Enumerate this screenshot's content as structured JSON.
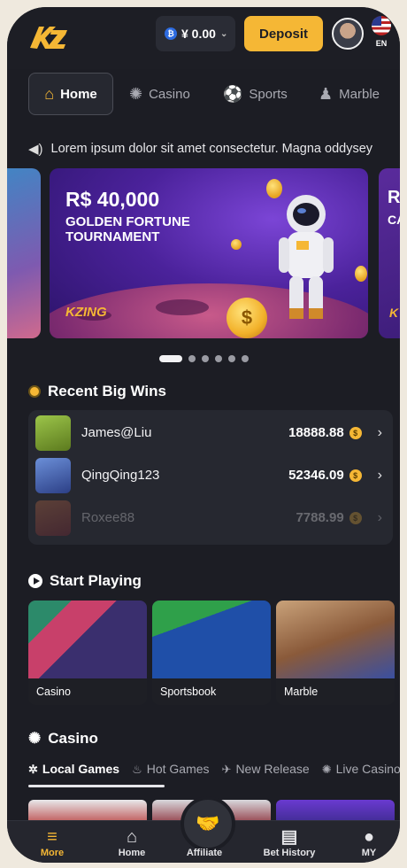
{
  "header": {
    "balance": "¥ 0.00",
    "balance_chevron": "⌄",
    "deposit_label": "Deposit",
    "language": "EN"
  },
  "nav": {
    "tabs": [
      {
        "label": "Home",
        "icon": "house-icon"
      },
      {
        "label": "Casino",
        "icon": "roulette-icon"
      },
      {
        "label": "Sports",
        "icon": "ball-icon"
      },
      {
        "label": "Marble",
        "icon": "chess-icon"
      }
    ]
  },
  "announcement": {
    "text": "Lorem ipsum dolor sit amet consectetur. Magna oddysey"
  },
  "banner": {
    "title": "R$ 40,000",
    "subtitle": "GOLDEN FORTUNE TOURNAMENT",
    "brand": "KZING",
    "next_title": "R",
    "next_sub": "CA",
    "next_brand": "K",
    "slides_count": 6,
    "active_slide": 0
  },
  "recent_wins": {
    "title": "Recent Big Wins",
    "rows": [
      {
        "user": "James@Liu",
        "amount": "18888.88",
        "thumb_color": "#6e8a2b"
      },
      {
        "user": "QingQing123",
        "amount": "52346.09",
        "thumb_color": "#3c5ea8"
      },
      {
        "user": "Roxee88",
        "amount": "7788.99",
        "thumb_color": "#8a3b36"
      }
    ]
  },
  "start_playing": {
    "title": "Start Playing",
    "cards": [
      {
        "label": "Casino"
      },
      {
        "label": "Sportsbook"
      },
      {
        "label": "Marble"
      }
    ]
  },
  "casino": {
    "title": "Casino",
    "subtabs": [
      {
        "label": "Local Games"
      },
      {
        "label": "Hot Games"
      },
      {
        "label": "New Release"
      },
      {
        "label": "Live Casino"
      }
    ]
  },
  "bottom_nav": {
    "items": [
      {
        "label": "More"
      },
      {
        "label": "Home"
      },
      {
        "label": "Affiliate"
      },
      {
        "label": "Bet History"
      },
      {
        "label": "MY"
      }
    ]
  },
  "colors": {
    "accent": "#f5b735",
    "background": "#1c1d24",
    "card": "#262830"
  }
}
